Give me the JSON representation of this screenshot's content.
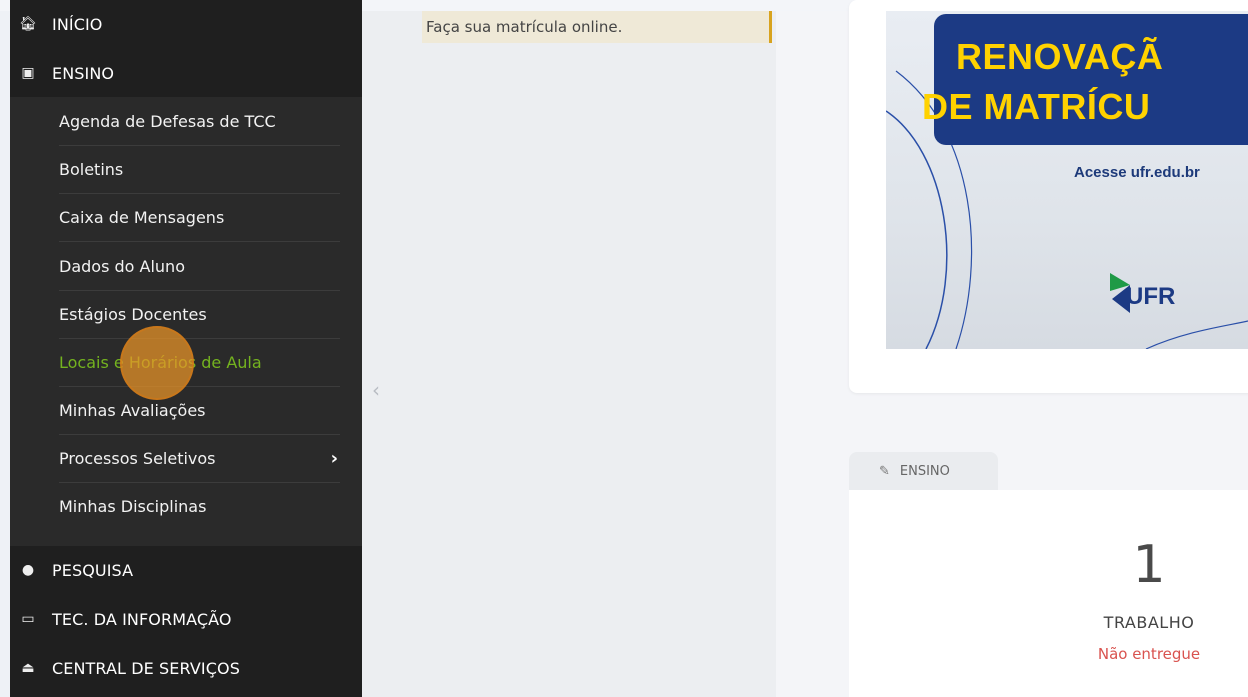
{
  "sidebar": {
    "top_items": [
      {
        "label": "INÍCIO",
        "icon": "home-icon"
      },
      {
        "label": "ENSINO",
        "icon": "teaching-icon"
      }
    ],
    "ensino_items": [
      {
        "label": "Agenda de Defesas de TCC"
      },
      {
        "label": "Boletins"
      },
      {
        "label": "Caixa de Mensagens"
      },
      {
        "label": "Dados do Aluno"
      },
      {
        "label": "Estágios Docentes"
      },
      {
        "label": "Locais e Horários de Aula",
        "active": true
      },
      {
        "label": "Minhas Avaliações"
      },
      {
        "label": "Processos Seletivos",
        "has_submenu": true
      },
      {
        "label": "Minhas Disciplinas"
      }
    ],
    "bottom_items": [
      {
        "label": "PESQUISA",
        "icon": "globe-icon"
      },
      {
        "label": "TEC. DA INFORMAÇÃO",
        "icon": "laptop-icon"
      },
      {
        "label": "CENTRAL DE SERVIÇOS",
        "icon": "eject-icon"
      }
    ]
  },
  "notice": {
    "text": "Faça sua matrícula online."
  },
  "banner": {
    "line1": "RENOVAÇÃ",
    "line2": "DE MATRÍCU",
    "access": "Acesse ufr.edu.br",
    "logo_text": "UFR"
  },
  "tab": {
    "label": "ENSINO",
    "icon": "pencil-icon"
  },
  "stat": {
    "number": "1",
    "label": "TRABALHO",
    "status": "Não entregue"
  },
  "colors": {
    "accent_active": "#74b31f",
    "status_red": "#d9534f",
    "banner_blue": "#1c3a84",
    "banner_yellow": "#ffd200"
  }
}
